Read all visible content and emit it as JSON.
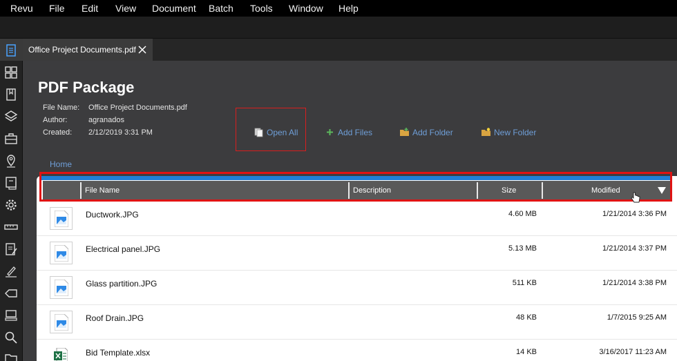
{
  "menubar": {
    "items": [
      "Revu",
      "File",
      "Edit",
      "View",
      "Document",
      "Batch",
      "Tools",
      "Window",
      "Help"
    ]
  },
  "tab": {
    "label": "Office Project Documents.pdf"
  },
  "package": {
    "title": "PDF Package",
    "meta": [
      {
        "label": "File Name:",
        "value": "Office Project Documents.pdf"
      },
      {
        "label": "Author:",
        "value": "agranados"
      },
      {
        "label": "Created:",
        "value": "2/12/2019 3:31 PM"
      }
    ],
    "actions": {
      "open_all": "Open All",
      "add_files": "Add Files",
      "add_folder": "Add Folder",
      "new_folder": "New Folder"
    },
    "breadcrumb": "Home"
  },
  "table": {
    "columns": {
      "file_name": "File Name",
      "description": "Description",
      "size": "Size",
      "modified": "Modified"
    },
    "rows": [
      {
        "name": "Ductwork.JPG",
        "size": "4.60 MB",
        "modified": "1/21/2014 3:36 PM",
        "icon": "image-file-icon"
      },
      {
        "name": "Electrical panel.JPG",
        "size": "5.13 MB",
        "modified": "1/21/2014 3:37 PM",
        "icon": "image-file-icon"
      },
      {
        "name": "Glass partition.JPG",
        "size": "511 KB",
        "modified": "1/21/2014 3:38 PM",
        "icon": "image-file-icon"
      },
      {
        "name": "Roof Drain.JPG",
        "size": "48 KB",
        "modified": "1/7/2015 9:25 AM",
        "icon": "image-file-icon"
      },
      {
        "name": "Bid Template.xlsx",
        "size": "14 KB",
        "modified": "3/16/2017 11:23 AM",
        "icon": "excel-file-icon"
      }
    ]
  },
  "colors": {
    "accent_blue": "#1f7fd6",
    "link_blue": "#6f9fd8",
    "highlight_red": "#e01313"
  }
}
